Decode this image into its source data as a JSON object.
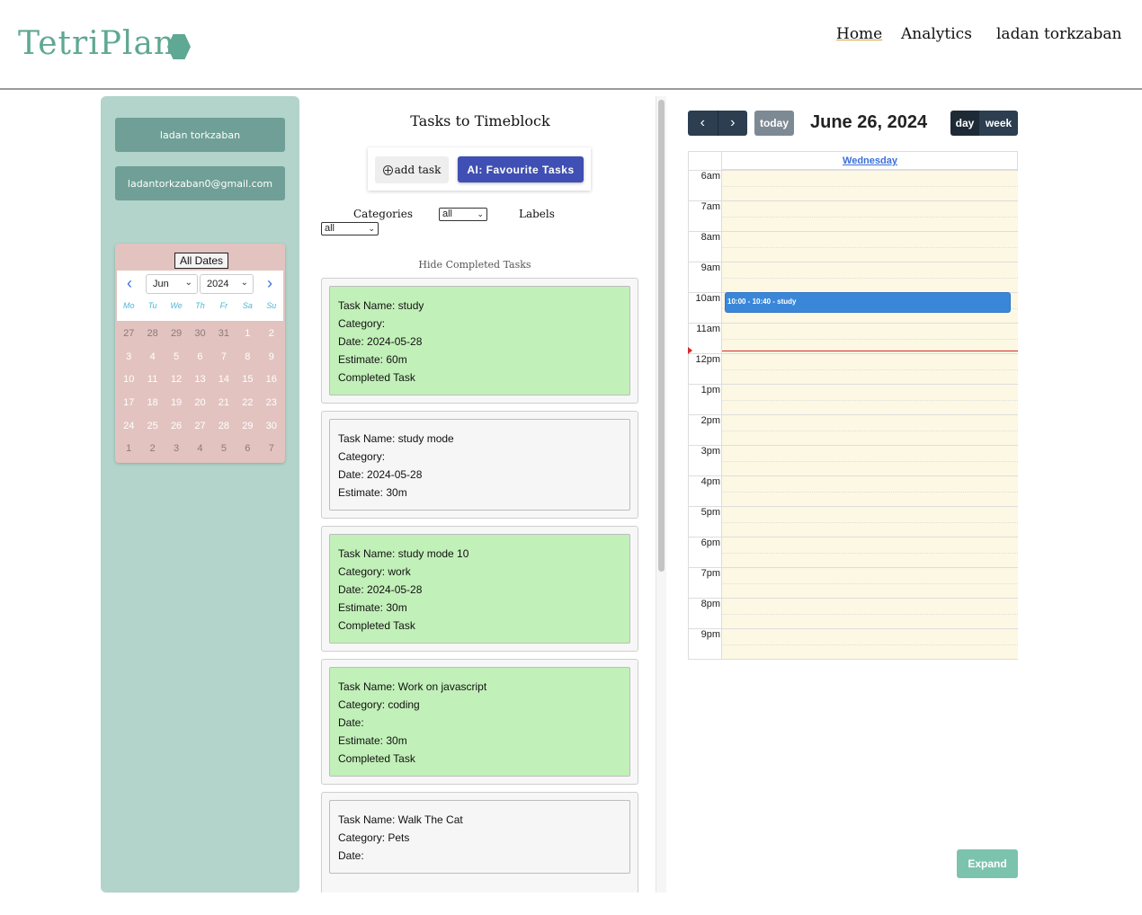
{
  "header": {
    "logo_text": "TetriPlan",
    "nav": {
      "home": "Home",
      "analytics": "Analytics",
      "user": "ladan torkzaban"
    }
  },
  "sidebar": {
    "name": "ladan torkzaban",
    "email": "ladantorkzaban0@gmail.com",
    "mini_calendar": {
      "all_dates_label": "All Dates",
      "month": "Jun",
      "year": "2024",
      "weekdays": [
        "Mo",
        "Tu",
        "We",
        "Th",
        "Fr",
        "Sa",
        "Su"
      ],
      "days": [
        {
          "d": "27",
          "muted": true
        },
        {
          "d": "28",
          "muted": true
        },
        {
          "d": "29",
          "muted": true
        },
        {
          "d": "30",
          "muted": true
        },
        {
          "d": "31",
          "muted": true
        },
        {
          "d": "1",
          "muted": false
        },
        {
          "d": "2",
          "muted": false
        },
        {
          "d": "3",
          "muted": false
        },
        {
          "d": "4",
          "muted": false
        },
        {
          "d": "5",
          "muted": false
        },
        {
          "d": "6",
          "muted": false
        },
        {
          "d": "7",
          "muted": false
        },
        {
          "d": "8",
          "muted": false
        },
        {
          "d": "9",
          "muted": false
        },
        {
          "d": "10",
          "muted": false
        },
        {
          "d": "11",
          "muted": false
        },
        {
          "d": "12",
          "muted": false
        },
        {
          "d": "13",
          "muted": false
        },
        {
          "d": "14",
          "muted": false
        },
        {
          "d": "15",
          "muted": false
        },
        {
          "d": "16",
          "muted": false
        },
        {
          "d": "17",
          "muted": false
        },
        {
          "d": "18",
          "muted": false
        },
        {
          "d": "19",
          "muted": false
        },
        {
          "d": "20",
          "muted": false
        },
        {
          "d": "21",
          "muted": false
        },
        {
          "d": "22",
          "muted": false
        },
        {
          "d": "23",
          "muted": false
        },
        {
          "d": "24",
          "muted": false
        },
        {
          "d": "25",
          "muted": false
        },
        {
          "d": "26",
          "muted": false
        },
        {
          "d": "27",
          "muted": false
        },
        {
          "d": "28",
          "muted": false
        },
        {
          "d": "29",
          "muted": false
        },
        {
          "d": "30",
          "muted": false
        },
        {
          "d": "1",
          "muted": true
        },
        {
          "d": "2",
          "muted": true
        },
        {
          "d": "3",
          "muted": true
        },
        {
          "d": "4",
          "muted": true
        },
        {
          "d": "5",
          "muted": true
        },
        {
          "d": "6",
          "muted": true
        },
        {
          "d": "7",
          "muted": true
        }
      ]
    }
  },
  "tasks_panel": {
    "title": "Tasks to Timeblock",
    "add_task_label": "add task",
    "ai_button_label": "AI: Favourite Tasks",
    "categories_label": "Categories",
    "categories_value": "all",
    "labels_label": "Labels",
    "labels_value": "all",
    "hide_completed_label": "Hide Completed Tasks",
    "tasks": [
      {
        "lines": [
          "Task Name: study",
          "Category:",
          "Date: 2024-05-28",
          "Estimate: 60m",
          "Completed Task"
        ],
        "completed": true
      },
      {
        "lines": [
          "Task Name: study mode",
          "Category:",
          "Date: 2024-05-28",
          "Estimate: 30m"
        ],
        "completed": false
      },
      {
        "lines": [
          "Task Name: study mode 10",
          "Category: work",
          "Date: 2024-05-28",
          "Estimate: 30m",
          "Completed Task"
        ],
        "completed": true
      },
      {
        "lines": [
          "Task Name: Work on javascript",
          "Category: coding",
          "Date:",
          "Estimate: 30m",
          "Completed Task"
        ],
        "completed": true
      },
      {
        "lines": [
          "Task Name: Walk The Cat",
          "Category: Pets",
          "Date:"
        ],
        "completed": false
      }
    ]
  },
  "calendar": {
    "prev_icon": "chevron-left-icon",
    "next_icon": "chevron-right-icon",
    "today_label": "today",
    "title": "June 26, 2024",
    "view_day_label": "day",
    "view_week_label": "week",
    "day_header": "Wednesday",
    "hours": [
      "6am",
      "7am",
      "8am",
      "9am",
      "10am",
      "11am",
      "12pm",
      "1pm",
      "2pm",
      "3pm",
      "4pm",
      "5pm",
      "6pm",
      "7pm",
      "8pm",
      "9pm"
    ],
    "first_hour": 6,
    "events": [
      {
        "label": "10:00 - 10:40 - study",
        "start_hour": 10.0,
        "end_hour": 10.67
      }
    ],
    "now_hour": 11.9,
    "expand_label": "Expand",
    "colors": {
      "event": "#3a87d9",
      "now_line": "#d12b2b",
      "day_bg": "#fcf8e3"
    }
  }
}
